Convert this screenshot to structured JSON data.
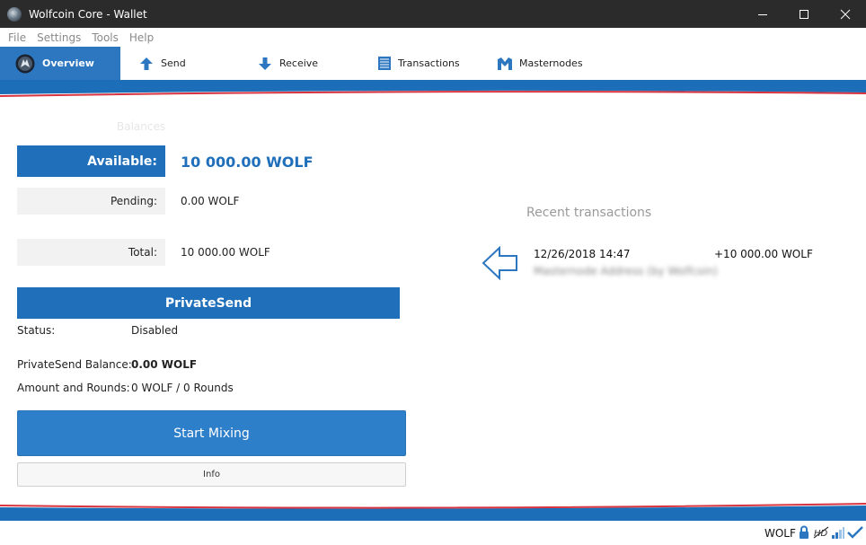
{
  "window": {
    "title": "Wolfcoin Core - Wallet"
  },
  "menu": {
    "items": [
      "File",
      "Settings",
      "Tools",
      "Help"
    ]
  },
  "nav": {
    "tabs": [
      {
        "label": "Overview",
        "icon": "wolf-logo-icon"
      },
      {
        "label": "Send",
        "icon": "arrow-up-icon"
      },
      {
        "label": "Receive",
        "icon": "arrow-down-icon"
      },
      {
        "label": "Transactions",
        "icon": "list-icon"
      },
      {
        "label": "Masternodes",
        "icon": "masternode-m-icon"
      }
    ]
  },
  "balances": {
    "title": "Balances",
    "available_label": "Available:",
    "available_value": "10 000.00 WOLF",
    "pending_label": "Pending:",
    "pending_value": "0.00 WOLF",
    "total_label": "Total:",
    "total_value": "10 000.00 WOLF"
  },
  "privatesend": {
    "header": "PrivateSend",
    "status_label": "Status:",
    "status_value": "Disabled",
    "balance_label": "PrivateSend Balance:",
    "balance_value": "0.00 WOLF",
    "rounds_label": "Amount and Rounds:",
    "rounds_value": "0 WOLF / 0 Rounds",
    "start_button": "Start Mixing",
    "info_button": "Info"
  },
  "recent": {
    "title": "Recent transactions",
    "transactions": [
      {
        "date": "12/26/2018 14:47",
        "amount": "+10 000.00 WOLF",
        "label": "Masternode Address (by Wolfcoin)"
      }
    ]
  },
  "statusbar": {
    "unit": "WOLF"
  },
  "colors": {
    "accent": "#1f6fba",
    "stripe": "#1c6eb8",
    "red_line": "#d8343f",
    "titlebar": "#2b2b2b"
  }
}
